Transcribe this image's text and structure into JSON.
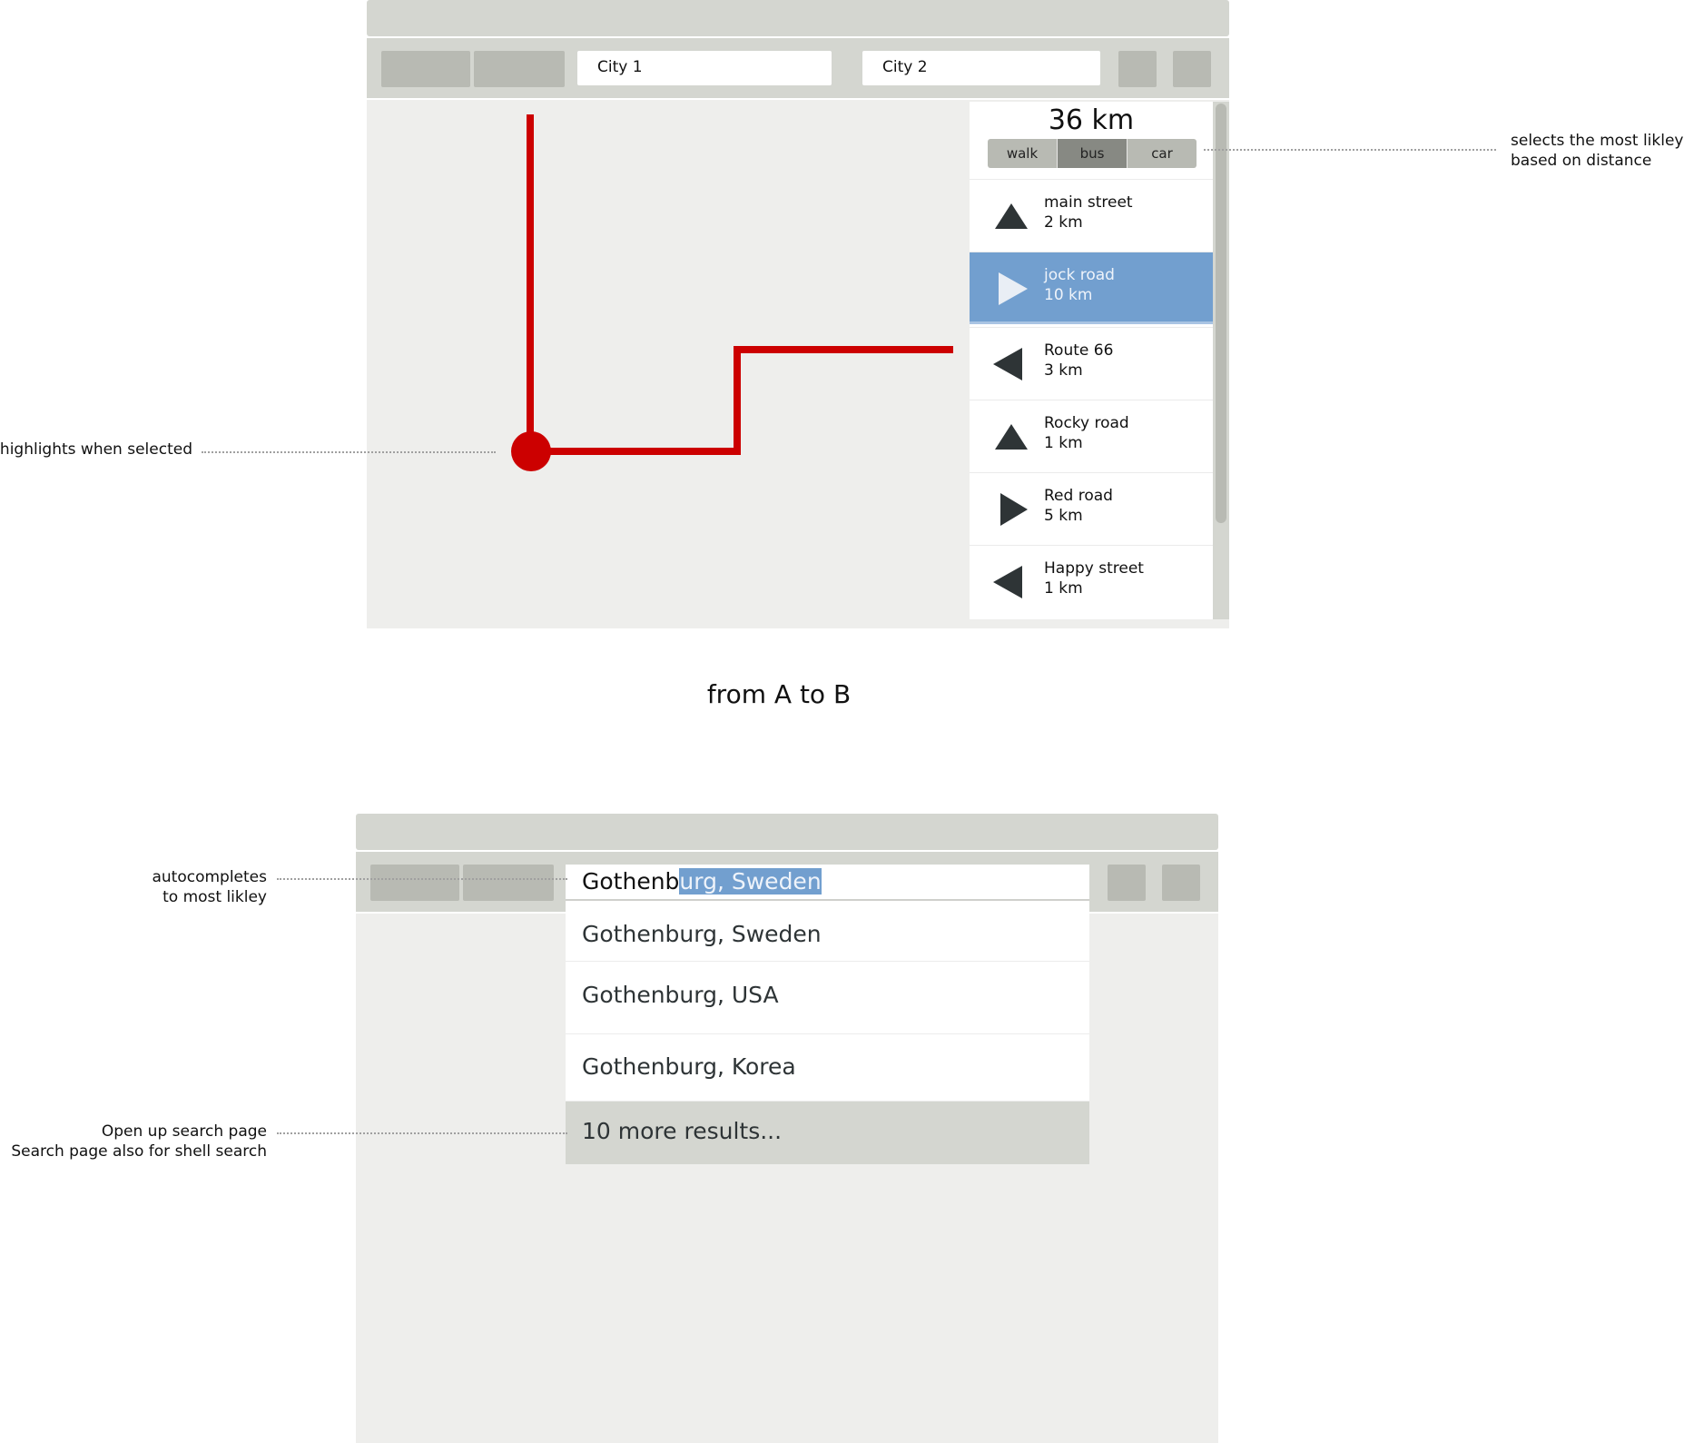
{
  "top_mockup": {
    "city1_field": "City 1",
    "city2_field": "City 2",
    "total_distance": "36 km",
    "modes": [
      {
        "label": "walk",
        "active": false
      },
      {
        "label": "bus",
        "active": true
      },
      {
        "label": "car",
        "active": false
      }
    ],
    "steps": [
      {
        "name": "main street",
        "distance": "2 km",
        "icon": "arrow-up-icon",
        "selected": false
      },
      {
        "name": "jock road",
        "distance": "10 km",
        "icon": "arrow-right-icon",
        "selected": true
      },
      {
        "name": "Route 66",
        "distance": "3 km",
        "icon": "arrow-left-icon",
        "selected": false
      },
      {
        "name": "Rocky road",
        "distance": "1 km",
        "icon": "arrow-up-icon",
        "selected": false
      },
      {
        "name": "Red road",
        "distance": "5 km",
        "icon": "arrow-right-icon",
        "selected": false
      },
      {
        "name": "Happy street",
        "distance": "1 km",
        "icon": "arrow-left-icon",
        "selected": false
      }
    ],
    "route_color": "#cc0000",
    "selection_color": "#729fcf"
  },
  "caption": "from A to B",
  "annotations": {
    "mode_note": [
      "selects the most likley",
      "based on distance"
    ],
    "map_note": "highlights when selected",
    "autocomplete_note": [
      "autocompletes",
      "to most likley"
    ],
    "more_note": [
      "Open up search page",
      "Search page also for shell search"
    ]
  },
  "bottom_mockup": {
    "search_typed": "Gothenb",
    "search_completion": "urg, Sweden",
    "suggestions": [
      "Gothenburg, Sweden",
      "Gothenburg, USA",
      "Gothenburg, Korea"
    ],
    "more_results": "10 more results..."
  }
}
